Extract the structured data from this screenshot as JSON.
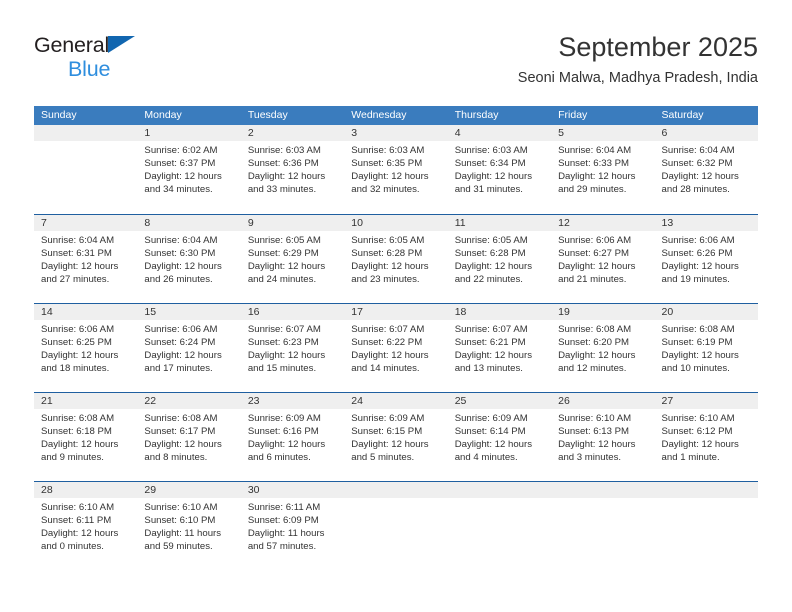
{
  "brand": {
    "name_part1": "General",
    "name_part2": "Blue",
    "triangle_icon": "blue-triangle-icon"
  },
  "header": {
    "title": "September 2025",
    "subtitle": "Seoni Malwa, Madhya Pradesh, India"
  },
  "colors": {
    "header_blue": "#3a7cbe",
    "row_divider_blue": "#1f5fa0",
    "day_band_gray": "#efefef",
    "brand_blue": "#2f8ede",
    "triangle_blue": "#1166b0",
    "text": "#333333"
  },
  "weekdays": [
    "Sunday",
    "Monday",
    "Tuesday",
    "Wednesday",
    "Thursday",
    "Friday",
    "Saturday"
  ],
  "labels": {
    "sunrise_prefix": "Sunrise:",
    "sunset_prefix": "Sunset:",
    "daylight_prefix": "Daylight:"
  },
  "weeks": [
    [
      {
        "day": "",
        "sunrise": "",
        "sunset": "",
        "daylight_line1": "",
        "daylight_line2": ""
      },
      {
        "day": "1",
        "sunrise": "Sunrise: 6:02 AM",
        "sunset": "Sunset: 6:37 PM",
        "daylight_line1": "Daylight: 12 hours",
        "daylight_line2": "and 34 minutes."
      },
      {
        "day": "2",
        "sunrise": "Sunrise: 6:03 AM",
        "sunset": "Sunset: 6:36 PM",
        "daylight_line1": "Daylight: 12 hours",
        "daylight_line2": "and 33 minutes."
      },
      {
        "day": "3",
        "sunrise": "Sunrise: 6:03 AM",
        "sunset": "Sunset: 6:35 PM",
        "daylight_line1": "Daylight: 12 hours",
        "daylight_line2": "and 32 minutes."
      },
      {
        "day": "4",
        "sunrise": "Sunrise: 6:03 AM",
        "sunset": "Sunset: 6:34 PM",
        "daylight_line1": "Daylight: 12 hours",
        "daylight_line2": "and 31 minutes."
      },
      {
        "day": "5",
        "sunrise": "Sunrise: 6:04 AM",
        "sunset": "Sunset: 6:33 PM",
        "daylight_line1": "Daylight: 12 hours",
        "daylight_line2": "and 29 minutes."
      },
      {
        "day": "6",
        "sunrise": "Sunrise: 6:04 AM",
        "sunset": "Sunset: 6:32 PM",
        "daylight_line1": "Daylight: 12 hours",
        "daylight_line2": "and 28 minutes."
      }
    ],
    [
      {
        "day": "7",
        "sunrise": "Sunrise: 6:04 AM",
        "sunset": "Sunset: 6:31 PM",
        "daylight_line1": "Daylight: 12 hours",
        "daylight_line2": "and 27 minutes."
      },
      {
        "day": "8",
        "sunrise": "Sunrise: 6:04 AM",
        "sunset": "Sunset: 6:30 PM",
        "daylight_line1": "Daylight: 12 hours",
        "daylight_line2": "and 26 minutes."
      },
      {
        "day": "9",
        "sunrise": "Sunrise: 6:05 AM",
        "sunset": "Sunset: 6:29 PM",
        "daylight_line1": "Daylight: 12 hours",
        "daylight_line2": "and 24 minutes."
      },
      {
        "day": "10",
        "sunrise": "Sunrise: 6:05 AM",
        "sunset": "Sunset: 6:28 PM",
        "daylight_line1": "Daylight: 12 hours",
        "daylight_line2": "and 23 minutes."
      },
      {
        "day": "11",
        "sunrise": "Sunrise: 6:05 AM",
        "sunset": "Sunset: 6:28 PM",
        "daylight_line1": "Daylight: 12 hours",
        "daylight_line2": "and 22 minutes."
      },
      {
        "day": "12",
        "sunrise": "Sunrise: 6:06 AM",
        "sunset": "Sunset: 6:27 PM",
        "daylight_line1": "Daylight: 12 hours",
        "daylight_line2": "and 21 minutes."
      },
      {
        "day": "13",
        "sunrise": "Sunrise: 6:06 AM",
        "sunset": "Sunset: 6:26 PM",
        "daylight_line1": "Daylight: 12 hours",
        "daylight_line2": "and 19 minutes."
      }
    ],
    [
      {
        "day": "14",
        "sunrise": "Sunrise: 6:06 AM",
        "sunset": "Sunset: 6:25 PM",
        "daylight_line1": "Daylight: 12 hours",
        "daylight_line2": "and 18 minutes."
      },
      {
        "day": "15",
        "sunrise": "Sunrise: 6:06 AM",
        "sunset": "Sunset: 6:24 PM",
        "daylight_line1": "Daylight: 12 hours",
        "daylight_line2": "and 17 minutes."
      },
      {
        "day": "16",
        "sunrise": "Sunrise: 6:07 AM",
        "sunset": "Sunset: 6:23 PM",
        "daylight_line1": "Daylight: 12 hours",
        "daylight_line2": "and 15 minutes."
      },
      {
        "day": "17",
        "sunrise": "Sunrise: 6:07 AM",
        "sunset": "Sunset: 6:22 PM",
        "daylight_line1": "Daylight: 12 hours",
        "daylight_line2": "and 14 minutes."
      },
      {
        "day": "18",
        "sunrise": "Sunrise: 6:07 AM",
        "sunset": "Sunset: 6:21 PM",
        "daylight_line1": "Daylight: 12 hours",
        "daylight_line2": "and 13 minutes."
      },
      {
        "day": "19",
        "sunrise": "Sunrise: 6:08 AM",
        "sunset": "Sunset: 6:20 PM",
        "daylight_line1": "Daylight: 12 hours",
        "daylight_line2": "and 12 minutes."
      },
      {
        "day": "20",
        "sunrise": "Sunrise: 6:08 AM",
        "sunset": "Sunset: 6:19 PM",
        "daylight_line1": "Daylight: 12 hours",
        "daylight_line2": "and 10 minutes."
      }
    ],
    [
      {
        "day": "21",
        "sunrise": "Sunrise: 6:08 AM",
        "sunset": "Sunset: 6:18 PM",
        "daylight_line1": "Daylight: 12 hours",
        "daylight_line2": "and 9 minutes."
      },
      {
        "day": "22",
        "sunrise": "Sunrise: 6:08 AM",
        "sunset": "Sunset: 6:17 PM",
        "daylight_line1": "Daylight: 12 hours",
        "daylight_line2": "and 8 minutes."
      },
      {
        "day": "23",
        "sunrise": "Sunrise: 6:09 AM",
        "sunset": "Sunset: 6:16 PM",
        "daylight_line1": "Daylight: 12 hours",
        "daylight_line2": "and 6 minutes."
      },
      {
        "day": "24",
        "sunrise": "Sunrise: 6:09 AM",
        "sunset": "Sunset: 6:15 PM",
        "daylight_line1": "Daylight: 12 hours",
        "daylight_line2": "and 5 minutes."
      },
      {
        "day": "25",
        "sunrise": "Sunrise: 6:09 AM",
        "sunset": "Sunset: 6:14 PM",
        "daylight_line1": "Daylight: 12 hours",
        "daylight_line2": "and 4 minutes."
      },
      {
        "day": "26",
        "sunrise": "Sunrise: 6:10 AM",
        "sunset": "Sunset: 6:13 PM",
        "daylight_line1": "Daylight: 12 hours",
        "daylight_line2": "and 3 minutes."
      },
      {
        "day": "27",
        "sunrise": "Sunrise: 6:10 AM",
        "sunset": "Sunset: 6:12 PM",
        "daylight_line1": "Daylight: 12 hours",
        "daylight_line2": "and 1 minute."
      }
    ],
    [
      {
        "day": "28",
        "sunrise": "Sunrise: 6:10 AM",
        "sunset": "Sunset: 6:11 PM",
        "daylight_line1": "Daylight: 12 hours",
        "daylight_line2": "and 0 minutes."
      },
      {
        "day": "29",
        "sunrise": "Sunrise: 6:10 AM",
        "sunset": "Sunset: 6:10 PM",
        "daylight_line1": "Daylight: 11 hours",
        "daylight_line2": "and 59 minutes."
      },
      {
        "day": "30",
        "sunrise": "Sunrise: 6:11 AM",
        "sunset": "Sunset: 6:09 PM",
        "daylight_line1": "Daylight: 11 hours",
        "daylight_line2": "and 57 minutes."
      },
      {
        "day": "",
        "sunrise": "",
        "sunset": "",
        "daylight_line1": "",
        "daylight_line2": ""
      },
      {
        "day": "",
        "sunrise": "",
        "sunset": "",
        "daylight_line1": "",
        "daylight_line2": ""
      },
      {
        "day": "",
        "sunrise": "",
        "sunset": "",
        "daylight_line1": "",
        "daylight_line2": ""
      },
      {
        "day": "",
        "sunrise": "",
        "sunset": "",
        "daylight_line1": "",
        "daylight_line2": ""
      }
    ]
  ]
}
